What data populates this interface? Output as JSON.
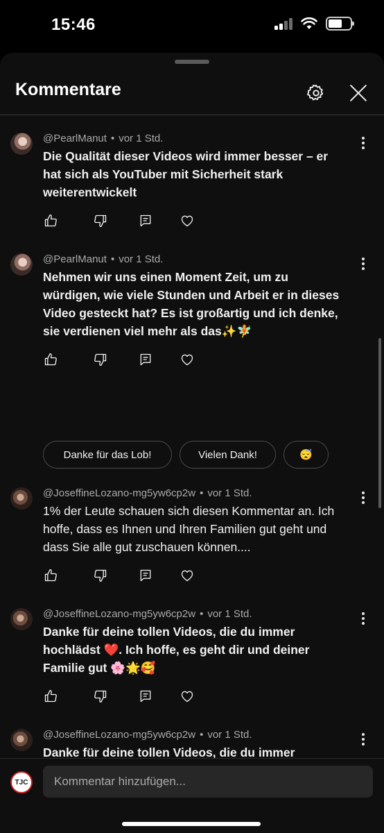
{
  "status": {
    "time": "15:46"
  },
  "sheet": {
    "title": "Kommentare"
  },
  "comments": [
    {
      "author": "@PearlManut",
      "time": "vor 1 Std.",
      "text": "Die Qualität dieser Videos wird immer besser – er hat sich als YouTuber mit Sicherheit stark weiterentwickelt"
    },
    {
      "author": "@PearlManut",
      "time": "vor 1 Std.",
      "text": "Nehmen wir uns einen Moment Zeit, um zu würdigen, wie viele Stunden und Arbeit er in dieses Video gesteckt hat? Es ist großartig und ich denke, sie verdienen viel mehr als das✨🧚"
    },
    {
      "author": "@JoseffineLozano-mg5yw6cp2w",
      "time": "vor 1 Std.",
      "text": "1% der Leute schauen sich diesen Kommentar an. Ich hoffe, dass es Ihnen und Ihren Familien gut geht und dass Sie alle gut zuschauen können...."
    },
    {
      "author": "@JoseffineLozano-mg5yw6cp2w",
      "time": "vor 1 Std.",
      "text": "Danke für deine tollen Videos, die du immer hochlädst ❤️. Ich hoffe, es geht dir und deiner Familie gut 🌸🌟🥰"
    },
    {
      "author": "@JoseffineLozano-mg5yw6cp2w",
      "time": "vor 1 Std.",
      "text": "Danke für deine tollen Videos, die du immer hochlädst ❤️. Ich hoffe, es geht dir und deiner Familie gut 🦋 ✨"
    }
  ],
  "reply_suggestions": [
    "Danke für das Lob!",
    "Vielen Dank!",
    "😴"
  ],
  "composer": {
    "placeholder": "Kommentar hinzufügen...",
    "avatar_text": "TJC"
  },
  "colors": {
    "background": "#0f0f0f",
    "text": "#f1f1f1",
    "meta": "#aaaaaa",
    "input": "#272727"
  },
  "icons": [
    "settings-icon",
    "close-icon",
    "more-vert-icon",
    "thumb-up-icon",
    "thumb-down-icon",
    "reply-icon",
    "heart-icon"
  ]
}
